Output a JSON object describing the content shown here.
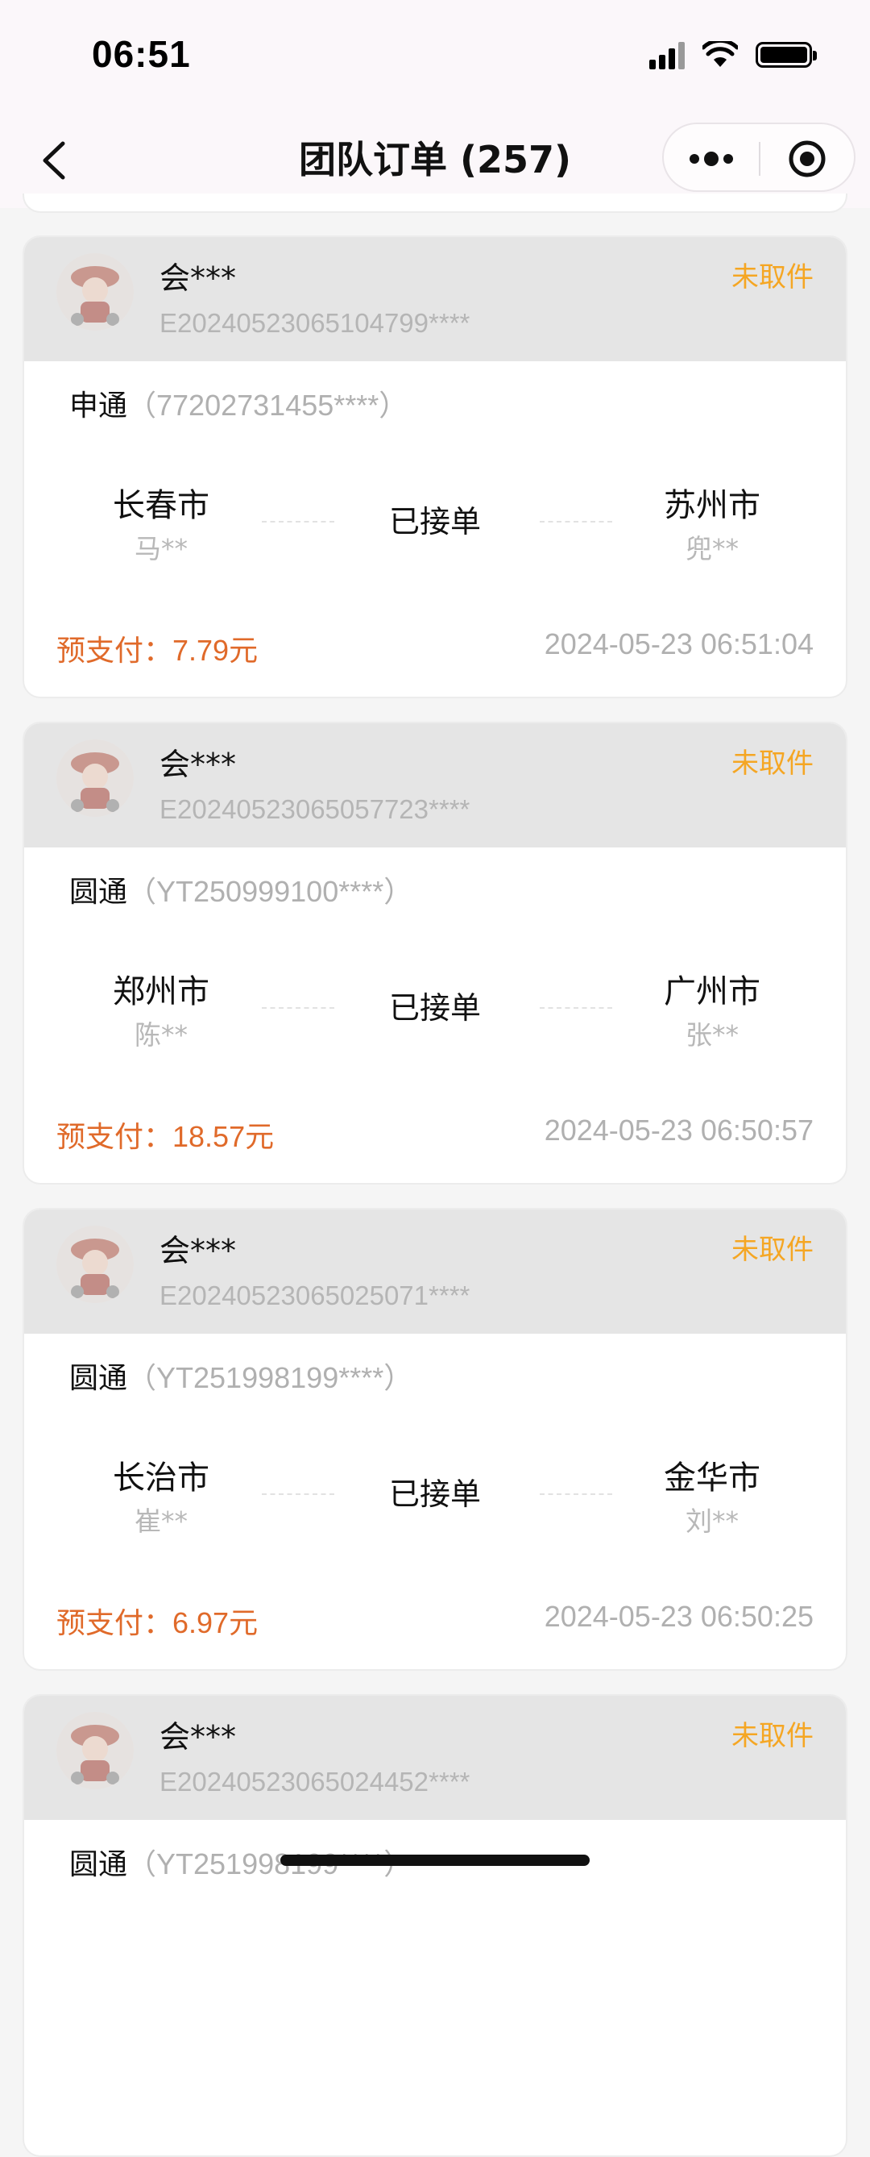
{
  "status_bar": {
    "time": "06:51"
  },
  "nav": {
    "title": "团队订单 (257)"
  },
  "orders": [
    {
      "member": "会***",
      "order_no": "E20240523065104799****",
      "pickup_status": "未取件",
      "courier": "申通",
      "tracking": "（77202731455****）",
      "origin_city": "长春市",
      "origin_person": "马**",
      "status": "已接单",
      "dest_city": "苏州市",
      "dest_person": "兜**",
      "prepay_label": "预支付：",
      "prepay_amount": "7.79元",
      "created_at": "2024-05-23 06:51:04"
    },
    {
      "member": "会***",
      "order_no": "E20240523065057723****",
      "pickup_status": "未取件",
      "courier": "圆通",
      "tracking": "（YT250999100****）",
      "origin_city": "郑州市",
      "origin_person": "陈**",
      "status": "已接单",
      "dest_city": "广州市",
      "dest_person": "张**",
      "prepay_label": "预支付：",
      "prepay_amount": "18.57元",
      "created_at": "2024-05-23 06:50:57"
    },
    {
      "member": "会***",
      "order_no": "E20240523065025071****",
      "pickup_status": "未取件",
      "courier": "圆通",
      "tracking": "（YT251998199****）",
      "origin_city": "长治市",
      "origin_person": "崔**",
      "status": "已接单",
      "dest_city": "金华市",
      "dest_person": "刘**",
      "prepay_label": "预支付：",
      "prepay_amount": "6.97元",
      "created_at": "2024-05-23 06:50:25"
    },
    {
      "member": "会***",
      "order_no": "E20240523065024452****",
      "pickup_status": "未取件",
      "courier": "圆通",
      "tracking": "（YT251998199****）",
      "origin_city": "",
      "origin_person": "",
      "status": "",
      "dest_city": "",
      "dest_person": "",
      "prepay_label": "",
      "prepay_amount": "",
      "created_at": ""
    }
  ]
}
